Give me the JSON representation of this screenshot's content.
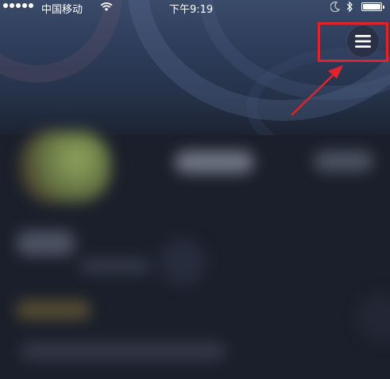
{
  "status_bar": {
    "carrier": "中国移动",
    "time": "下午9:19",
    "signal_strength": 5,
    "battery_level": 1.0
  },
  "header": {
    "menu_icon": "hamburger-menu-icon"
  },
  "annotation": {
    "color": "#e0232c",
    "highlight_target": "menu-button"
  },
  "colors": {
    "background": "#1a1f2b",
    "header_top": "#3a4a6a",
    "menu_button_bg": "#2a3147"
  }
}
